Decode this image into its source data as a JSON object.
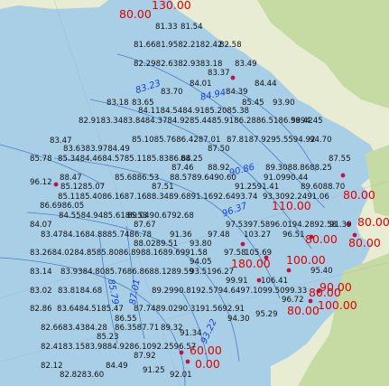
{
  "map": {
    "colors": {
      "sea": "#a9cfe6",
      "land": "#e7ecd2",
      "forest": "#c6dba4",
      "contour": "#3e6fbd",
      "red_label": "#e00000",
      "blue_label": "#1a3fd6",
      "station_dot": "#c0134d"
    },
    "red_labels": [
      "80.00",
      "130.00",
      "80.00",
      "80.00",
      "80.00",
      "110.00",
      "80.00",
      "180.00",
      "100.00",
      "80.00",
      "90.00",
      "80.00",
      "100.00",
      "60.00",
      "0.00"
    ],
    "contour_labels": [
      "83.23",
      "84.94",
      "90.86",
      "96.37",
      "85.79",
      "87.01",
      "93.22"
    ],
    "values": [
      "81.33",
      "81.54",
      "81.6681.9582.2182.42",
      "82.58",
      "82.2982.6382.9383.18",
      "83.37",
      "83.49",
      "84.01",
      "84.44",
      "83.70",
      "84.39",
      "83.18",
      "83.65",
      "85.45",
      "93.90",
      "84.1184.5484.9185.2085.38",
      "82.9183.3483.8484.3784.9285.4485.9186.2886.5186.5994.45",
      "98.42",
      "83.47",
      "85.1085.7686.4287.01",
      "87.8187.9295.5594.92",
      "94.70",
      "83.6383.9784.49",
      "87.50",
      "85.78",
      "85.3484.4684.5785.1185.8386.64",
      "88.25",
      "87.55",
      "87.46",
      "88.92",
      "89.3088.8688.25",
      "96.12",
      "88.47",
      "85.6886.53",
      "88.5789.6490.60",
      "91.0990.44",
      "85.1285.07",
      "87.51",
      "91.2591.41",
      "89.6088.70",
      "85.1185.4086.1687.1688.3489.6891.1692.6493.74",
      "93.3092.2491.06",
      "86.6986.05",
      "84.5584.9485.6186.53",
      "89.0490.6792.68",
      "84.07",
      "87.67",
      "97.5397.5896.0194.2892.58",
      "91.39",
      "83.4784.1684.8885.7486.78",
      "97.48",
      "103.27",
      "96.51",
      "88.0289.51",
      "91.36",
      "93.80",
      "83.2684.0284.8585.8086.8988.1689.6991.58",
      "97.58",
      "105.69",
      "94.05",
      "95.40",
      "83.14",
      "83.9384.8085.7686.8688.1289.59",
      "93.5196.27",
      "83.02",
      "83.8184.68",
      "89.2990.8192.5794.6497.1099.5099.33",
      "99.91",
      "106.41",
      "82.86",
      "83.6484.5185.47",
      "96.72",
      "86.55",
      "87.7489.0290.3191.5692.91",
      "95.29",
      "94.30",
      "82.6683.4384.28",
      "86.3587.71",
      "89.32",
      "91.34",
      "85.23",
      "82.4183.1583.9884.9286.10",
      "92.2596.57",
      "87.92",
      "82.12",
      "84.49",
      "91.25",
      "92.01",
      "82.8283.60"
    ]
  }
}
